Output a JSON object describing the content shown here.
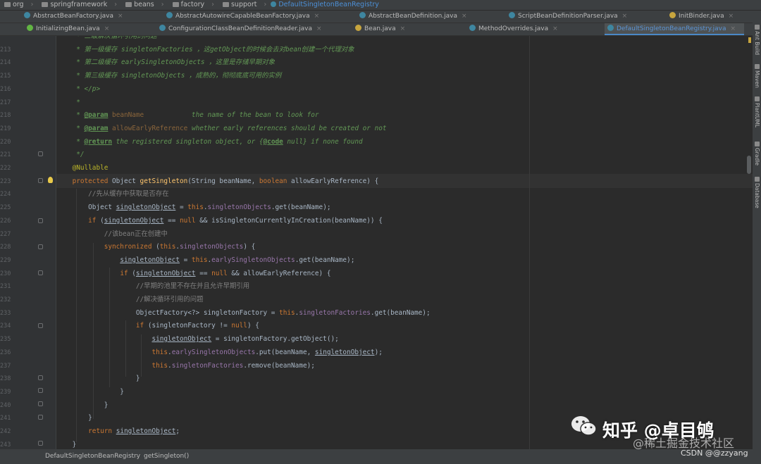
{
  "breadcrumb": {
    "items": [
      "org",
      "springframework",
      "beans",
      "factory",
      "support"
    ],
    "current": "DefaultSingletonBeanRegistry"
  },
  "tabs_row1": [
    {
      "label": "AbstractBeanFactory.java"
    },
    {
      "label": "AbstractAutowireCapableBeanFactory.java"
    },
    {
      "label": "AbstractBeanDefinition.java"
    },
    {
      "label": "ScriptBeanDefinitionParser.java"
    },
    {
      "label": "InitBinder.java"
    }
  ],
  "tabs_row2": [
    {
      "label": "InitializingBean.java"
    },
    {
      "label": "ConfigurationClassBeanDefinitionReader.java"
    },
    {
      "label": "Bean.java"
    },
    {
      "label": "MethodOverrides.java"
    },
    {
      "label": "DefaultSingletonBeanRegistry.java",
      "active": true
    }
  ],
  "right_tool_windows": [
    "Ant Build",
    "Maven",
    "PlantUML",
    "Gradle",
    "Database"
  ],
  "line_numbers": [
    "",
    "213",
    "214",
    "215",
    "216",
    "217",
    "218",
    "219",
    "220",
    "221",
    "222",
    "223",
    "224",
    "225",
    "226",
    "227",
    "228",
    "229",
    "230",
    "231",
    "232",
    "233",
    "234",
    "235",
    "236",
    "237",
    "238",
    "239",
    "240",
    "241",
    "242",
    "243"
  ],
  "code_lines": [
    [
      {
        "t": "     * 三级解决循环引用的问题",
        "c": "cm"
      }
    ],
    [
      {
        "t": "     * 第一级缓存 ",
        "c": "cm"
      },
      {
        "t": "singletonFactories",
        "c": "cm"
      },
      {
        "t": " ，这getObject的时候会去对bean创建一个代理对象",
        "c": "cm"
      }
    ],
    [
      {
        "t": "     * 第二级缓存 ",
        "c": "cm"
      },
      {
        "t": "earlySingletonObjects",
        "c": "cm"
      },
      {
        "t": " ，这里是存储早期对象",
        "c": "cm"
      }
    ],
    [
      {
        "t": "     * 第三级缓存 ",
        "c": "cm"
      },
      {
        "t": "singletonObjects",
        "c": "cm"
      },
      {
        "t": " ，成熟的，彻彻底底可用的实例",
        "c": "cm"
      }
    ],
    [
      {
        "t": "     * </p>",
        "c": "cm"
      }
    ],
    [
      {
        "t": "     *",
        "c": "cm"
      }
    ],
    [
      {
        "t": "     * ",
        "c": "cm"
      },
      {
        "t": "@param",
        "c": "tag"
      },
      {
        "t": " ",
        "c": "cm"
      },
      {
        "t": "beanName",
        "c": "par"
      },
      {
        "t": "            the name of the bean to look for",
        "c": "doc"
      }
    ],
    [
      {
        "t": "     * ",
        "c": "cm"
      },
      {
        "t": "@param",
        "c": "tag"
      },
      {
        "t": " ",
        "c": "cm"
      },
      {
        "t": "allowEarlyReference",
        "c": "par"
      },
      {
        "t": " whether early references should be created or not",
        "c": "doc"
      }
    ],
    [
      {
        "t": "     * ",
        "c": "cm"
      },
      {
        "t": "@return",
        "c": "tag"
      },
      {
        "t": " the registered singleton object, or ",
        "c": "doc"
      },
      {
        "t": "{",
        "c": "doc"
      },
      {
        "t": "@code",
        "c": "tag"
      },
      {
        "t": " null} if none found",
        "c": "doc"
      }
    ],
    [
      {
        "t": "     */",
        "c": "cm"
      }
    ],
    [
      {
        "t": "    @Nullable",
        "c": "ann"
      }
    ],
    [
      {
        "t": "    ",
        "c": ""
      },
      {
        "t": "protected",
        "c": "kw"
      },
      {
        "t": " Object ",
        "c": ""
      },
      {
        "t": "getSingleton",
        "c": "fn"
      },
      {
        "t": "(String beanName, ",
        "c": ""
      },
      {
        "t": "boolean",
        "c": "kw"
      },
      {
        "t": " allowEarlyReference) {",
        "c": ""
      }
    ],
    [
      {
        "t": "        //先从缓存中获取是否存在",
        "c": "lc"
      }
    ],
    [
      {
        "t": "        Object ",
        "c": ""
      },
      {
        "t": "singletonObject",
        "c": "var"
      },
      {
        "t": " = ",
        "c": ""
      },
      {
        "t": "this",
        "c": "kw"
      },
      {
        "t": ".",
        "c": ""
      },
      {
        "t": "singletonObjects",
        "c": "fld"
      },
      {
        "t": ".get(beanName);",
        "c": ""
      }
    ],
    [
      {
        "t": "        ",
        "c": ""
      },
      {
        "t": "if",
        "c": "kw"
      },
      {
        "t": " (",
        "c": ""
      },
      {
        "t": "singletonObject",
        "c": "var"
      },
      {
        "t": " == ",
        "c": ""
      },
      {
        "t": "null",
        "c": "kw"
      },
      {
        "t": " && isSingletonCurrentlyInCreation(beanName)) {",
        "c": ""
      }
    ],
    [
      {
        "t": "            //该bean正在创建中",
        "c": "lc"
      }
    ],
    [
      {
        "t": "            ",
        "c": ""
      },
      {
        "t": "synchronized",
        "c": "kw"
      },
      {
        "t": " (",
        "c": ""
      },
      {
        "t": "this",
        "c": "kw"
      },
      {
        "t": ".",
        "c": ""
      },
      {
        "t": "singletonObjects",
        "c": "fld"
      },
      {
        "t": ") {",
        "c": ""
      }
    ],
    [
      {
        "t": "                ",
        "c": ""
      },
      {
        "t": "singletonObject",
        "c": "var"
      },
      {
        "t": " = ",
        "c": ""
      },
      {
        "t": "this",
        "c": "kw"
      },
      {
        "t": ".",
        "c": ""
      },
      {
        "t": "earlySingletonObjects",
        "c": "fld"
      },
      {
        "t": ".get(beanName);",
        "c": ""
      }
    ],
    [
      {
        "t": "                ",
        "c": ""
      },
      {
        "t": "if",
        "c": "kw"
      },
      {
        "t": " (",
        "c": ""
      },
      {
        "t": "singletonObject",
        "c": "var"
      },
      {
        "t": " == ",
        "c": ""
      },
      {
        "t": "null",
        "c": "kw"
      },
      {
        "t": " && allowEarlyReference) {",
        "c": ""
      }
    ],
    [
      {
        "t": "                    //早期的池里不存在并且允许早期引用",
        "c": "lc"
      }
    ],
    [
      {
        "t": "                    //解决循环引用的问题",
        "c": "lc"
      }
    ],
    [
      {
        "t": "                    ObjectFactory<?> singletonFactory = ",
        "c": ""
      },
      {
        "t": "this",
        "c": "kw"
      },
      {
        "t": ".",
        "c": ""
      },
      {
        "t": "singletonFactories",
        "c": "fld"
      },
      {
        "t": ".get(beanName);",
        "c": ""
      }
    ],
    [
      {
        "t": "                    ",
        "c": ""
      },
      {
        "t": "if",
        "c": "kw"
      },
      {
        "t": " (singletonFactory != ",
        "c": ""
      },
      {
        "t": "null",
        "c": "kw"
      },
      {
        "t": ") {",
        "c": ""
      }
    ],
    [
      {
        "t": "                        ",
        "c": ""
      },
      {
        "t": "singletonObject",
        "c": "var"
      },
      {
        "t": " = singletonFactory.getObject();",
        "c": ""
      }
    ],
    [
      {
        "t": "                        ",
        "c": ""
      },
      {
        "t": "this",
        "c": "kw"
      },
      {
        "t": ".",
        "c": ""
      },
      {
        "t": "earlySingletonObjects",
        "c": "fld"
      },
      {
        "t": ".put(beanName, ",
        "c": ""
      },
      {
        "t": "singletonObject",
        "c": "var"
      },
      {
        "t": ");",
        "c": ""
      }
    ],
    [
      {
        "t": "                        ",
        "c": ""
      },
      {
        "t": "this",
        "c": "kw"
      },
      {
        "t": ".",
        "c": ""
      },
      {
        "t": "singletonFactories",
        "c": "fld"
      },
      {
        "t": ".remove(beanName);",
        "c": ""
      }
    ],
    [
      {
        "t": "                    }",
        "c": ""
      }
    ],
    [
      {
        "t": "                }",
        "c": ""
      }
    ],
    [
      {
        "t": "            }",
        "c": ""
      }
    ],
    [
      {
        "t": "        }",
        "c": ""
      }
    ],
    [
      {
        "t": "        ",
        "c": ""
      },
      {
        "t": "return",
        "c": "kw"
      },
      {
        "t": " ",
        "c": ""
      },
      {
        "t": "singletonObject",
        "c": "var"
      },
      {
        "t": ";",
        "c": ""
      }
    ],
    [
      {
        "t": "    }",
        "c": ""
      }
    ]
  ],
  "status_bar": {
    "crumbs": [
      "DefaultSingletonBeanRegistry",
      "getSingleton()"
    ]
  },
  "watermarks": {
    "main": "知乎 @卓目鸲",
    "sub": "@稀土掘金技术社区",
    "csdn": "CSDN @@zzyang"
  },
  "colors": {
    "editor_bg": "#2b2b2b",
    "keyword": "#cc7832",
    "comment": "#629755",
    "function": "#ffc66d",
    "field": "#9876aa",
    "annotation": "#bbb529",
    "tab_active_text": "#5b95d6"
  }
}
